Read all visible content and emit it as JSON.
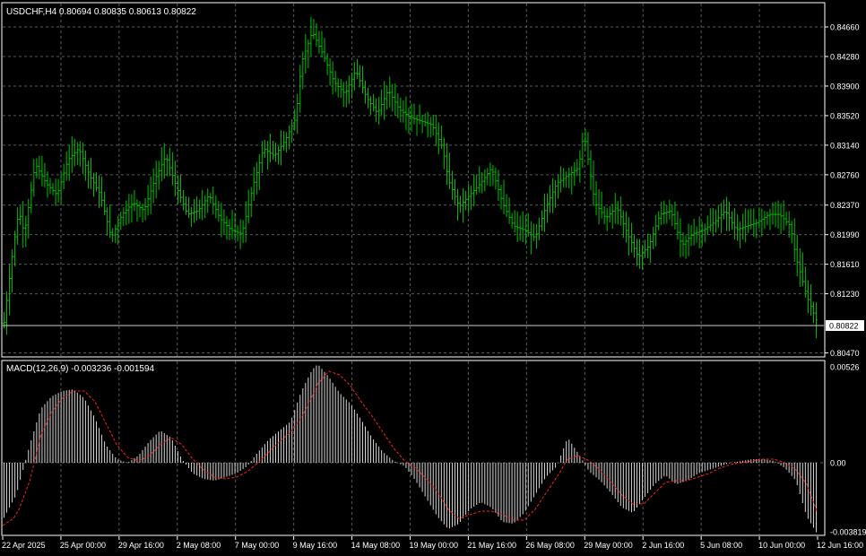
{
  "header": {
    "symbol_info": "USDCHF,H4  0.80694 0.80835 0.80613 0.80822",
    "macd_info": "MACD(12,26,9) -0.003236 -0.001594"
  },
  "colors": {
    "background": "#000000",
    "candle": "#00c000",
    "grid": "#5a5a5a",
    "macd_hist": "#d8d8d8",
    "signal": "#ff2020",
    "frame": "#ffffff"
  },
  "chart_data": [
    {
      "type": "line",
      "title": "USDCHF,H4",
      "price_axis": {
        "ticks": [
          "0.84660",
          "0.84280",
          "0.83900",
          "0.83520",
          "0.83140",
          "0.82760",
          "0.82370",
          "0.81990",
          "0.81610",
          "0.81230",
          "0.80470"
        ],
        "ylim": [
          0.8043,
          0.8496
        ],
        "current_price": "0.80822"
      },
      "time_axis": {
        "ticks": [
          "22 Apr 2025",
          "25 Apr 00:00",
          "29 Apr 16:00",
          "2 May 08:00",
          "7 May 00:00",
          "9 May 16:00",
          "14 May 08:00",
          "19 May 00:00",
          "21 May 16:00",
          "26 May 08:00",
          "29 May 00:00",
          "2 Jun 16:00",
          "5 Jun 08:00",
          "10 Jun 00:00",
          "12 Jun 16:00"
        ]
      },
      "bar_count": 300,
      "close_path": [
        [
          0,
          0.8072
        ],
        [
          4,
          0.8185
        ],
        [
          6,
          0.823
        ],
        [
          8,
          0.82
        ],
        [
          12,
          0.829
        ],
        [
          16,
          0.8265
        ],
        [
          20,
          0.825
        ],
        [
          24,
          0.8295
        ],
        [
          28,
          0.831
        ],
        [
          32,
          0.8275
        ],
        [
          36,
          0.825
        ],
        [
          40,
          0.8195
        ],
        [
          44,
          0.8225
        ],
        [
          48,
          0.824
        ],
        [
          52,
          0.823
        ],
        [
          56,
          0.827
        ],
        [
          60,
          0.83
        ],
        [
          64,
          0.826
        ],
        [
          68,
          0.8225
        ],
        [
          72,
          0.823
        ],
        [
          76,
          0.825
        ],
        [
          80,
          0.822
        ],
        [
          84,
          0.8205
        ],
        [
          88,
          0.82
        ],
        [
          92,
          0.826
        ],
        [
          96,
          0.831
        ],
        [
          100,
          0.83
        ],
        [
          104,
          0.832
        ],
        [
          108,
          0.835
        ],
        [
          110,
          0.842
        ],
        [
          114,
          0.846
        ],
        [
          118,
          0.843
        ],
        [
          122,
          0.8395
        ],
        [
          126,
          0.838
        ],
        [
          130,
          0.841
        ],
        [
          134,
          0.8375
        ],
        [
          138,
          0.8355
        ],
        [
          142,
          0.8385
        ],
        [
          146,
          0.836
        ],
        [
          150,
          0.835
        ],
        [
          154,
          0.8345
        ],
        [
          158,
          0.834
        ],
        [
          162,
          0.831
        ],
        [
          164,
          0.827
        ],
        [
          168,
          0.8235
        ],
        [
          172,
          0.825
        ],
        [
          176,
          0.8265
        ],
        [
          180,
          0.8285
        ],
        [
          184,
          0.824
        ],
        [
          188,
          0.821
        ],
        [
          192,
          0.8205
        ],
        [
          196,
          0.8195
        ],
        [
          200,
          0.8235
        ],
        [
          204,
          0.8265
        ],
        [
          208,
          0.8275
        ],
        [
          212,
          0.8285
        ],
        [
          214,
          0.833
        ],
        [
          218,
          0.824
        ],
        [
          222,
          0.822
        ],
        [
          226,
          0.8235
        ],
        [
          230,
          0.82
        ],
        [
          234,
          0.817
        ],
        [
          238,
          0.8185
        ],
        [
          242,
          0.8225
        ],
        [
          246,
          0.823
        ],
        [
          250,
          0.8185
        ],
        [
          254,
          0.82
        ],
        [
          258,
          0.8205
        ],
        [
          262,
          0.8215
        ],
        [
          266,
          0.823
        ],
        [
          270,
          0.8205
        ],
        [
          274,
          0.821
        ],
        [
          278,
          0.8215
        ],
        [
          282,
          0.8225
        ],
        [
          286,
          0.8225
        ],
        [
          290,
          0.821
        ],
        [
          292,
          0.817
        ],
        [
          296,
          0.812
        ],
        [
          300,
          0.8085
        ]
      ]
    },
    {
      "type": "bar",
      "title": "MACD(12,26,9)",
      "axis_ticks": [
        "0.00526",
        "0.00",
        "-0.003819"
      ],
      "ylim": [
        -0.004,
        0.00565
      ],
      "macd_path": [
        [
          0,
          -0.0032
        ],
        [
          5,
          -0.0018
        ],
        [
          10,
          0.001
        ],
        [
          14,
          0.003
        ],
        [
          18,
          0.0037
        ],
        [
          22,
          0.004
        ],
        [
          26,
          0.0041
        ],
        [
          30,
          0.0036
        ],
        [
          34,
          0.0025
        ],
        [
          38,
          0.001
        ],
        [
          42,
          0.0002
        ],
        [
          46,
          0.0
        ],
        [
          50,
          0.0004
        ],
        [
          54,
          0.0012
        ],
        [
          58,
          0.0018
        ],
        [
          62,
          0.0014
        ],
        [
          66,
          0.0002
        ],
        [
          70,
          -0.0006
        ],
        [
          74,
          -0.0009
        ],
        [
          78,
          -0.001
        ],
        [
          82,
          -0.0008
        ],
        [
          86,
          -0.0006
        ],
        [
          90,
          -0.0002
        ],
        [
          94,
          0.0006
        ],
        [
          98,
          0.0013
        ],
        [
          102,
          0.0018
        ],
        [
          106,
          0.0023
        ],
        [
          110,
          0.004
        ],
        [
          114,
          0.0052
        ],
        [
          116,
          0.0055
        ],
        [
          120,
          0.0048
        ],
        [
          124,
          0.0039
        ],
        [
          128,
          0.0033
        ],
        [
          132,
          0.0024
        ],
        [
          136,
          0.0014
        ],
        [
          140,
          0.0006
        ],
        [
          144,
          0.0001
        ],
        [
          148,
          -0.0002
        ],
        [
          152,
          -0.001
        ],
        [
          156,
          -0.002
        ],
        [
          160,
          -0.003
        ],
        [
          164,
          -0.0037
        ],
        [
          168,
          -0.0034
        ],
        [
          172,
          -0.0026
        ],
        [
          176,
          -0.0022
        ],
        [
          180,
          -0.0025
        ],
        [
          184,
          -0.0033
        ],
        [
          188,
          -0.0034
        ],
        [
          192,
          -0.0028
        ],
        [
          196,
          -0.0018
        ],
        [
          200,
          -0.0008
        ],
        [
          204,
          -0.0002
        ],
        [
          208,
          0.0014
        ],
        [
          212,
          0.0005
        ],
        [
          216,
          -0.0005
        ],
        [
          220,
          -0.001
        ],
        [
          224,
          -0.0017
        ],
        [
          228,
          -0.0025
        ],
        [
          232,
          -0.0028
        ],
        [
          236,
          -0.002
        ],
        [
          240,
          -0.0012
        ],
        [
          244,
          -0.0007
        ],
        [
          248,
          -0.0012
        ],
        [
          252,
          -0.001
        ],
        [
          256,
          -0.0006
        ],
        [
          260,
          -0.0004
        ],
        [
          264,
          -0.0002
        ],
        [
          268,
          0.0
        ],
        [
          272,
          0.0001
        ],
        [
          276,
          0.0002
        ],
        [
          280,
          0.0002
        ],
        [
          284,
          0.0001
        ],
        [
          288,
          -0.0003
        ],
        [
          292,
          -0.001
        ],
        [
          296,
          -0.003
        ],
        [
          300,
          -0.004
        ]
      ],
      "signal_path": [
        [
          0,
          -0.0035
        ],
        [
          5,
          -0.003
        ],
        [
          10,
          -0.001
        ],
        [
          14,
          0.0015
        ],
        [
          18,
          0.0028
        ],
        [
          22,
          0.0036
        ],
        [
          26,
          0.004
        ],
        [
          30,
          0.004
        ],
        [
          34,
          0.0034
        ],
        [
          38,
          0.0022
        ],
        [
          42,
          0.001
        ],
        [
          46,
          0.0003
        ],
        [
          50,
          0.0001
        ],
        [
          54,
          0.0004
        ],
        [
          58,
          0.001
        ],
        [
          62,
          0.0014
        ],
        [
          66,
          0.001
        ],
        [
          70,
          0.0002
        ],
        [
          74,
          -0.0004
        ],
        [
          78,
          -0.0008
        ],
        [
          82,
          -0.0009
        ],
        [
          86,
          -0.0008
        ],
        [
          90,
          -0.0005
        ],
        [
          94,
          0.0
        ],
        [
          98,
          0.0006
        ],
        [
          102,
          0.0012
        ],
        [
          106,
          0.0017
        ],
        [
          110,
          0.0025
        ],
        [
          114,
          0.0037
        ],
        [
          116,
          0.0044
        ],
        [
          120,
          0.0051
        ],
        [
          124,
          0.0049
        ],
        [
          128,
          0.0043
        ],
        [
          132,
          0.0034
        ],
        [
          136,
          0.0026
        ],
        [
          140,
          0.0017
        ],
        [
          144,
          0.0008
        ],
        [
          148,
          0.0001
        ],
        [
          152,
          -0.0003
        ],
        [
          156,
          -0.0009
        ],
        [
          160,
          -0.0016
        ],
        [
          164,
          -0.0026
        ],
        [
          168,
          -0.0031
        ],
        [
          172,
          -0.0029
        ],
        [
          176,
          -0.0027
        ],
        [
          180,
          -0.0027
        ],
        [
          184,
          -0.0029
        ],
        [
          188,
          -0.0032
        ],
        [
          192,
          -0.0032
        ],
        [
          196,
          -0.0026
        ],
        [
          200,
          -0.0017
        ],
        [
          204,
          -0.0008
        ],
        [
          208,
          0.0002
        ],
        [
          212,
          0.0004
        ],
        [
          216,
          0.0001
        ],
        [
          220,
          -0.0004
        ],
        [
          224,
          -0.0011
        ],
        [
          228,
          -0.0018
        ],
        [
          232,
          -0.0023
        ],
        [
          236,
          -0.0023
        ],
        [
          240,
          -0.0017
        ],
        [
          244,
          -0.0011
        ],
        [
          248,
          -0.001
        ],
        [
          252,
          -0.001
        ],
        [
          256,
          -0.0008
        ],
        [
          260,
          -0.0006
        ],
        [
          264,
          -0.0003
        ],
        [
          268,
          -0.0001
        ],
        [
          272,
          0.0
        ],
        [
          276,
          0.0001
        ],
        [
          280,
          0.0002
        ],
        [
          284,
          0.0002
        ],
        [
          288,
          0.0
        ],
        [
          292,
          -0.0004
        ],
        [
          296,
          -0.0012
        ],
        [
          300,
          -0.0028
        ]
      ]
    }
  ]
}
